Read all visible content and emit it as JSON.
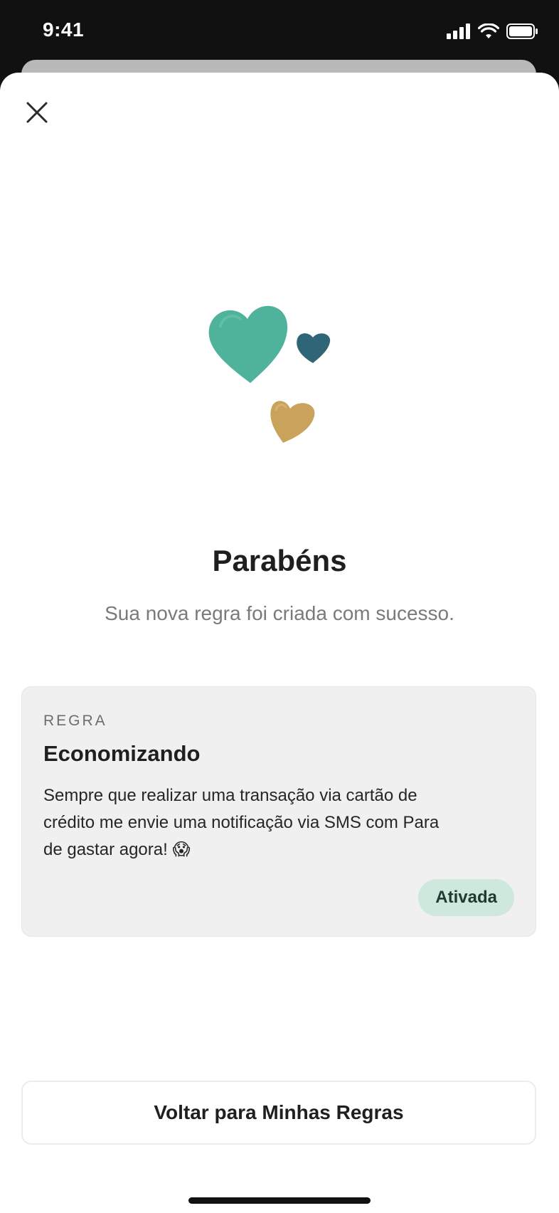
{
  "status_bar": {
    "time": "9:41"
  },
  "sheet": {
    "close_icon": "close-icon",
    "illustration": "hearts-illustration",
    "title": "Parabéns",
    "subtitle": "Sua nova regra foi criada com sucesso."
  },
  "rule_card": {
    "kicker": "REGRA",
    "name": "Economizando",
    "description": "Sempre que realizar uma transação via cartão de crédito me envie uma notificação via SMS com Para de gastar agora! 😱",
    "status": "Ativada"
  },
  "actions": {
    "back_button": "Voltar para Minhas Regras"
  },
  "colors": {
    "accent_teal": "#4fb29a",
    "accent_dark_teal": "#2e6677",
    "accent_gold": "#c9a25b",
    "badge_bg": "#cfe8dd"
  }
}
